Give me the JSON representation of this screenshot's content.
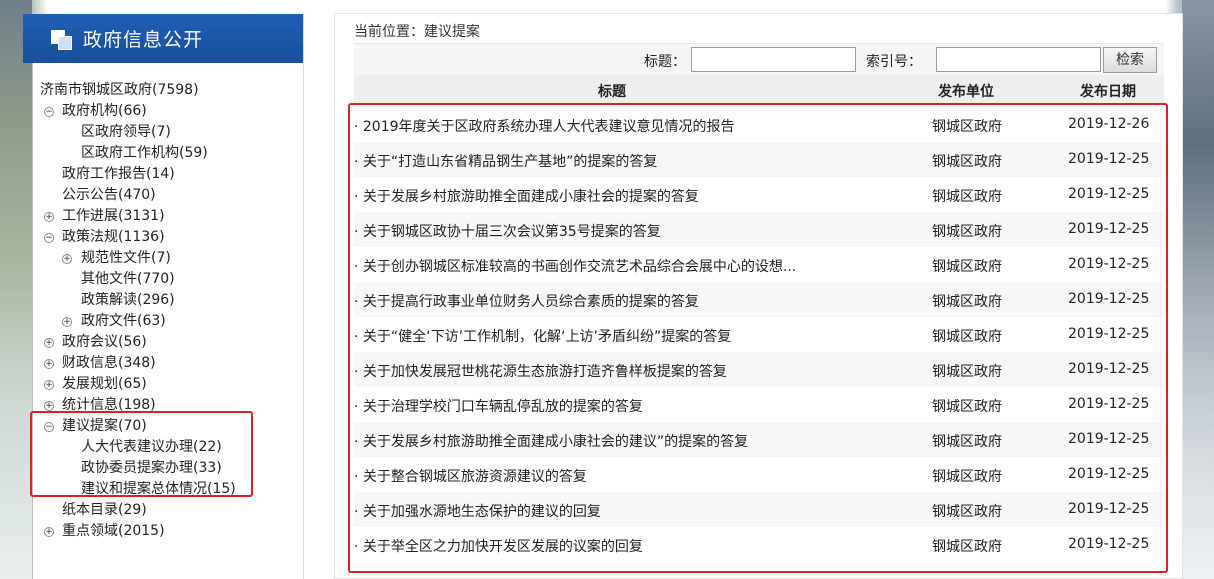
{
  "sidebar": {
    "title": "政府信息公开",
    "tree": [
      {
        "label": "济南市钢城区政府(7598)",
        "level": 0,
        "toggle": ""
      },
      {
        "label": "政府机构(66)",
        "level": 1,
        "toggle": "minus"
      },
      {
        "label": "区政府领导(7)",
        "level": 2,
        "toggle": ""
      },
      {
        "label": "区政府工作机构(59)",
        "level": 2,
        "toggle": ""
      },
      {
        "label": "政府工作报告(14)",
        "level": 1,
        "toggle": ""
      },
      {
        "label": "公示公告(470)",
        "level": 1,
        "toggle": ""
      },
      {
        "label": "工作进展(3131)",
        "level": 1,
        "toggle": "plus"
      },
      {
        "label": "政策法规(1136)",
        "level": 1,
        "toggle": "minus"
      },
      {
        "label": "规范性文件(7)",
        "level": 2,
        "toggle": "plus"
      },
      {
        "label": "其他文件(770)",
        "level": 2,
        "toggle": ""
      },
      {
        "label": "政策解读(296)",
        "level": 2,
        "toggle": ""
      },
      {
        "label": "政府文件(63)",
        "level": 2,
        "toggle": "plus"
      },
      {
        "label": "政府会议(56)",
        "level": 1,
        "toggle": "plus"
      },
      {
        "label": "财政信息(348)",
        "level": 1,
        "toggle": "plus"
      },
      {
        "label": "发展规划(65)",
        "level": 1,
        "toggle": "plus"
      },
      {
        "label": "统计信息(198)",
        "level": 1,
        "toggle": "plus"
      },
      {
        "label": "建议提案(70)",
        "level": 1,
        "toggle": "minus"
      },
      {
        "label": "人大代表建议办理(22)",
        "level": 2,
        "toggle": ""
      },
      {
        "label": "政协委员提案办理(33)",
        "level": 2,
        "toggle": ""
      },
      {
        "label": "建议和提案总体情况(15)",
        "level": 2,
        "toggle": ""
      },
      {
        "label": "纸本目录(29)",
        "level": 1,
        "toggle": ""
      },
      {
        "label": "重点领域(2015)",
        "level": 1,
        "toggle": "plus"
      }
    ]
  },
  "main": {
    "breadcrumb": "当前位置：建议提案",
    "search": {
      "title_label": "标题：",
      "title_value": "",
      "index_label": "索引号：",
      "index_value": "",
      "button_label": "检索"
    },
    "columns": {
      "title": "标题",
      "unit": "发布单位",
      "date": "发布日期"
    },
    "rows": [
      {
        "title": "· 2019年度关于区政府系统办理人大代表建议意见情况的报告",
        "unit": "钢城区政府",
        "date": "2019-12-26"
      },
      {
        "title": "· 关于“打造山东省精品钢生产基地”的提案的答复",
        "unit": "钢城区政府",
        "date": "2019-12-25"
      },
      {
        "title": "· 关于发展乡村旅游助推全面建成小康社会的提案的答复",
        "unit": "钢城区政府",
        "date": "2019-12-25"
      },
      {
        "title": "· 关于钢城区政协十届三次会议第35号提案的答复",
        "unit": "钢城区政府",
        "date": "2019-12-25"
      },
      {
        "title": "· 关于创办钢城区标准较高的书画创作交流艺术品综合会展中心的设想...",
        "unit": "钢城区政府",
        "date": "2019-12-25"
      },
      {
        "title": "· 关于提高行政事业单位财务人员综合素质的提案的答复",
        "unit": "钢城区政府",
        "date": "2019-12-25"
      },
      {
        "title": "· 关于“健全‘下访’工作机制，化解‘上访’矛盾纠纷”提案的答复",
        "unit": "钢城区政府",
        "date": "2019-12-25"
      },
      {
        "title": "· 关于加快发展冠世桃花源生态旅游打造齐鲁样板提案的答复",
        "unit": "钢城区政府",
        "date": "2019-12-25"
      },
      {
        "title": "· 关于治理学校门口车辆乱停乱放的提案的答复",
        "unit": "钢城区政府",
        "date": "2019-12-25"
      },
      {
        "title": "· 关于发展乡村旅游助推全面建成小康社会的建议”的提案的答复",
        "unit": "钢城区政府",
        "date": "2019-12-25"
      },
      {
        "title": "· 关于整合钢城区旅游资源建议的答复",
        "unit": "钢城区政府",
        "date": "2019-12-25"
      },
      {
        "title": "· 关于加强水源地生态保护的建议的回复",
        "unit": "钢城区政府",
        "date": "2019-12-25"
      },
      {
        "title": "· 关于举全区之力加快开发区发展的议案的回复",
        "unit": "钢城区政府",
        "date": "2019-12-25"
      }
    ]
  },
  "colors": {
    "header_blue": "#1f5fb3",
    "highlight_red": "#e0201e"
  }
}
